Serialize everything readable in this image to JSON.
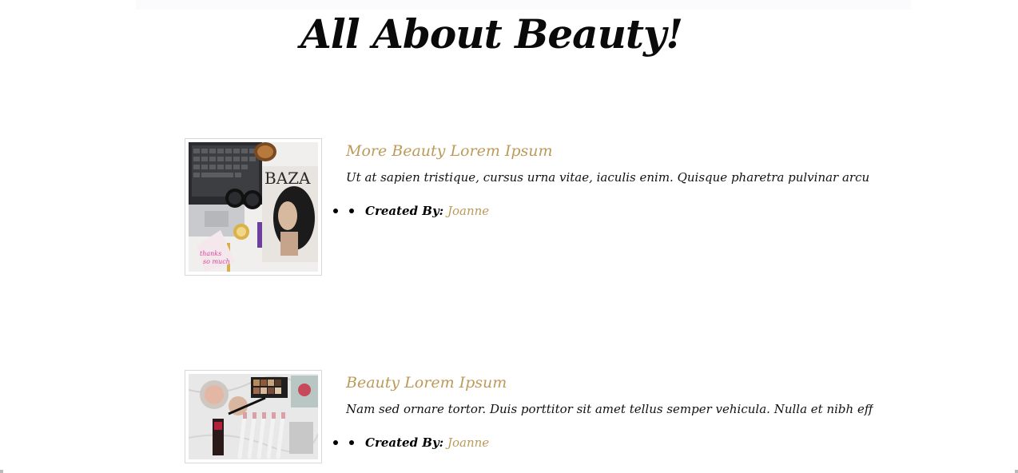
{
  "page": {
    "title": "All About Beauty!"
  },
  "posts": [
    {
      "title": "More Beauty Lorem Ipsum",
      "excerpt": "Ut at sapien tristique, cursus urna vitae, iaculis enim. Quisque pharetra pulvinar arcu et pulvin...",
      "author_label": "Created By:",
      "author_name": "Joanne",
      "image": "flatlay-laptop-magazine-image"
    },
    {
      "title": "Beauty Lorem Ipsum",
      "excerpt": "Nam sed ornare tortor. Duis porttitor sit amet tellus semper vehicula. Nulla et nibh efficitur, t...",
      "author_label": "Created By:",
      "author_name": "Joanne",
      "image": "flatlay-makeup-brushes-image"
    }
  ],
  "colors": {
    "accent": "#bd9a5a",
    "text": "#111111",
    "frame_border": "#d8d8d8"
  }
}
